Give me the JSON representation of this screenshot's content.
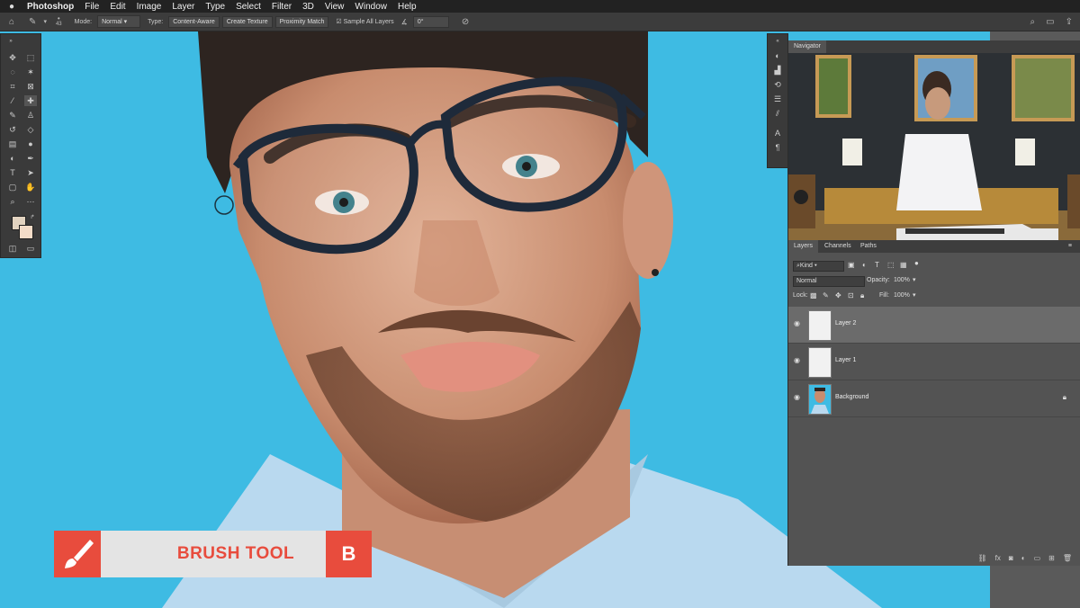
{
  "menubar": {
    "app": "Photoshop",
    "items": [
      "File",
      "Edit",
      "Image",
      "Layer",
      "Type",
      "Select",
      "Filter",
      "3D",
      "View",
      "Window",
      "Help"
    ]
  },
  "options": {
    "brush_size": "43",
    "mode_label": "Mode:",
    "mode_value": "Normal",
    "type_label": "Type:",
    "type_options": [
      "Content-Aware",
      "Create Texture",
      "Proximity Match"
    ],
    "sample_all_layers": "Sample All Layers",
    "angle": "0°"
  },
  "navigator": {
    "tab": "Navigator"
  },
  "layers": {
    "tabs": [
      "Layers",
      "Channels",
      "Paths"
    ],
    "filter": "Kind",
    "blend_mode": "Normal",
    "opacity_label": "Opacity:",
    "opacity": "100%",
    "lock_label": "Lock:",
    "fill_label": "Fill:",
    "fill": "100%",
    "items": [
      {
        "name": "Layer 2",
        "selected": true
      },
      {
        "name": "Layer 1",
        "selected": false
      },
      {
        "name": "Background",
        "selected": false,
        "locked": true
      }
    ]
  },
  "overlay": {
    "title": "BRUSH TOOL",
    "shortcut": "B"
  },
  "colors": {
    "accent": "#e84c3d",
    "canvas_bg": "#3ebbe3",
    "foreground_swatch": "#e2d3c0",
    "background_swatch": "#f3dcc8"
  }
}
